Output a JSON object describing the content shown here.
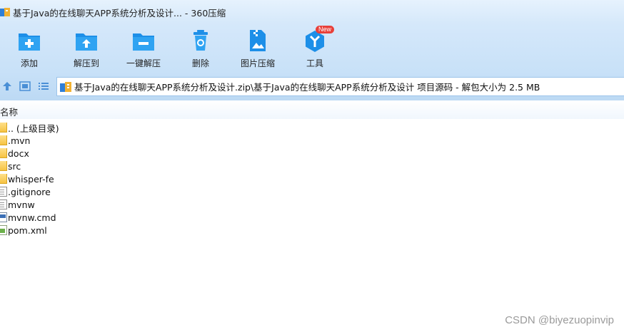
{
  "window": {
    "title": "基于Java的在线聊天APP系统分析及设计... - 360压缩"
  },
  "toolbar": {
    "items": [
      {
        "label": "添加",
        "icon": "add-folder-icon"
      },
      {
        "label": "解压到",
        "icon": "extract-to-icon"
      },
      {
        "label": "一键解压",
        "icon": "one-click-extract-icon"
      },
      {
        "label": "删除",
        "icon": "trash-icon"
      },
      {
        "label": "图片压缩",
        "icon": "image-compress-icon"
      },
      {
        "label": "工具",
        "icon": "tools-icon",
        "badge": "New"
      }
    ]
  },
  "address": {
    "path": "基于Java的在线聊天APP系统分析及设计.zip\\基于Java的在线聊天APP系统分析及设计 项目源码 - 解包大小为 2.5 MB"
  },
  "list": {
    "column_name": "名称",
    "files": [
      {
        "name": ".. (上级目录)",
        "type": "folder"
      },
      {
        "name": ".mvn",
        "type": "folder"
      },
      {
        "name": "docx",
        "type": "folder"
      },
      {
        "name": "src",
        "type": "folder"
      },
      {
        "name": "whisper-fe",
        "type": "folder"
      },
      {
        "name": ".gitignore",
        "type": "file"
      },
      {
        "name": "mvnw",
        "type": "file"
      },
      {
        "name": "mvnw.cmd",
        "type": "cmd"
      },
      {
        "name": "pom.xml",
        "type": "xml"
      }
    ]
  },
  "watermark": "CSDN @biyezuopinvip",
  "colors": {
    "accent": "#1e90e6",
    "toolbar_bg": "#d5e8fa",
    "badge": "#e8403a"
  }
}
